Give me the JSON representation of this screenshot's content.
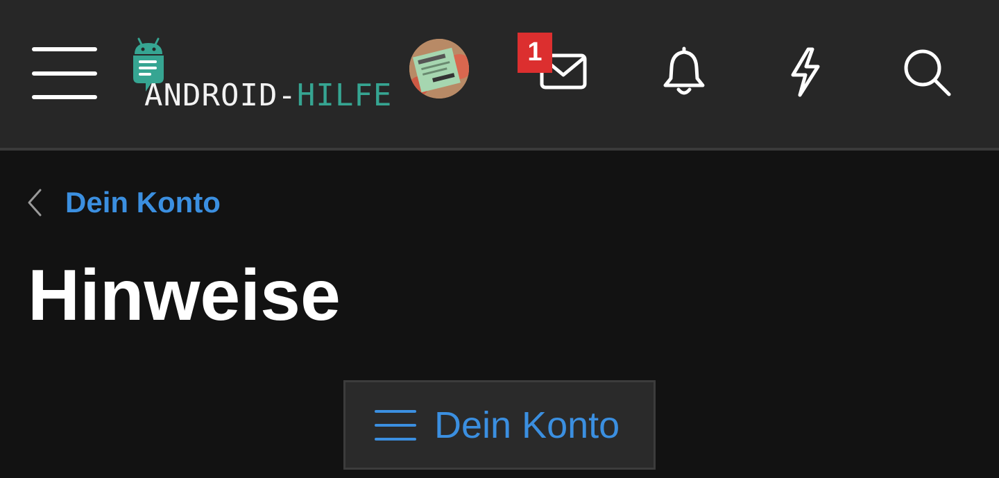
{
  "header": {
    "menu_icon": "hamburger-menu-icon",
    "logo": {
      "part1": "ANDROID-",
      "part2": "HILFE",
      "color_primary": "#f2f2f2",
      "color_accent": "#36a592"
    },
    "avatar_icon": "user-avatar",
    "messages": {
      "icon": "envelope-icon",
      "badge": "1",
      "badge_color": "#dc2f2f"
    },
    "notifications_icon": "bell-icon",
    "whats_new_icon": "lightning-icon",
    "search_icon": "search-icon"
  },
  "breadcrumb": {
    "back_icon": "chevron-left-icon",
    "label": "Dein Konto"
  },
  "page": {
    "title": "Hinweise"
  },
  "section_button": {
    "icon": "list-menu-icon",
    "label": "Dein Konto"
  },
  "colors": {
    "background": "#121212",
    "header": "#272727",
    "link": "#3b8fe0"
  }
}
